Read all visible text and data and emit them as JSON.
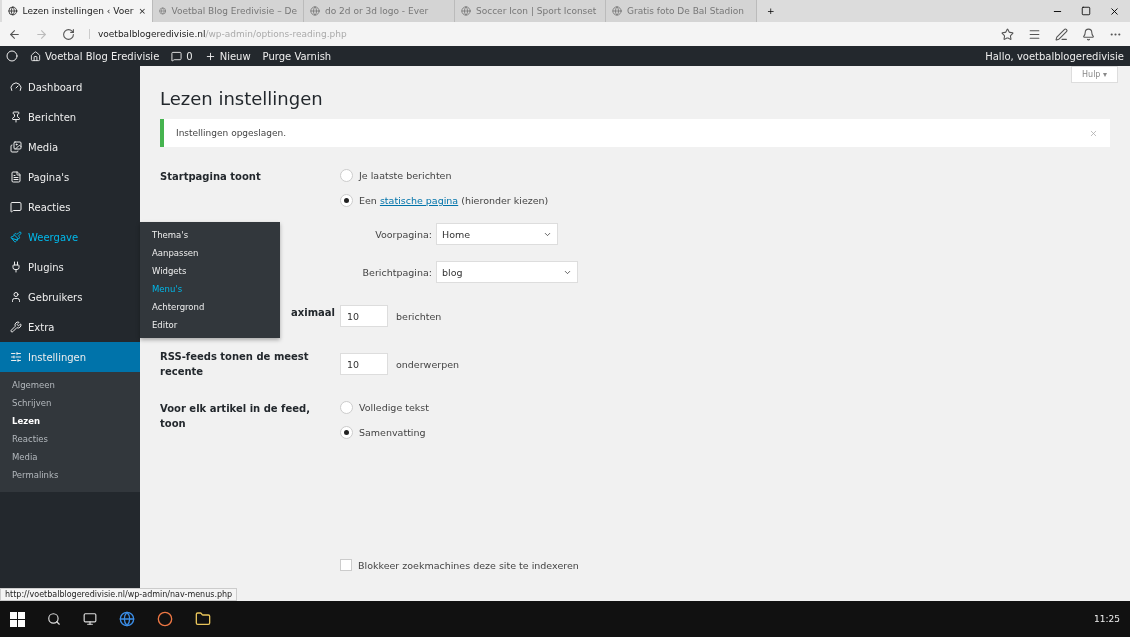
{
  "browser": {
    "tabs": [
      {
        "title": "Lezen instellingen ‹ Voer",
        "selected": true,
        "close": "×"
      },
      {
        "title": "Voetbal Blog Eredivisie – De",
        "selected": false
      },
      {
        "title": "do 2d or 3d logo - Ever",
        "selected": false
      },
      {
        "title": "Soccer Icon | Sport Iconset",
        "selected": false
      },
      {
        "title": "Gratis foto De Bal Stadion",
        "selected": false
      }
    ],
    "new_tab": "+",
    "url_host": "voetbalblogeredivisie.nl",
    "url_path": "/wp-admin/options-reading.php"
  },
  "admin_bar": {
    "site": "Voetbal Blog Eredivisie",
    "comments": "0",
    "new": "Nieuw",
    "purge": "Purge Varnish",
    "greeting": "Hallo, voetbalblogeredivisie"
  },
  "sidebar": {
    "items": [
      {
        "label": "Dashboard",
        "selected": false,
        "hovered": false
      },
      {
        "label": "Berichten",
        "selected": false,
        "hovered": false
      },
      {
        "label": "Media",
        "selected": false,
        "hovered": false
      },
      {
        "label": "Pagina's",
        "selected": false,
        "hovered": false
      },
      {
        "label": "Reacties",
        "selected": false,
        "hovered": false
      },
      {
        "label": "Weergave",
        "selected": false,
        "hovered": true,
        "flyout": [
          {
            "label": "Thema's",
            "hovered": false
          },
          {
            "label": "Aanpassen",
            "hovered": false
          },
          {
            "label": "Widgets",
            "hovered": false
          },
          {
            "label": "Menu's",
            "hovered": true
          },
          {
            "label": "Achtergrond",
            "hovered": false
          },
          {
            "label": "Editor",
            "hovered": false
          }
        ]
      },
      {
        "label": "Plugins",
        "selected": false,
        "hovered": false
      },
      {
        "label": "Gebruikers",
        "selected": false,
        "hovered": false
      },
      {
        "label": "Extra",
        "selected": false,
        "hovered": false
      },
      {
        "label": "Instellingen",
        "selected": true,
        "hovered": false,
        "children": [
          {
            "label": "Algemeen",
            "selected": false
          },
          {
            "label": "Schrijven",
            "selected": false
          },
          {
            "label": "Lezen",
            "selected": true
          },
          {
            "label": "Reacties",
            "selected": false
          },
          {
            "label": "Media",
            "selected": false
          },
          {
            "label": "Permalinks",
            "selected": false
          }
        ]
      }
    ]
  },
  "page": {
    "title": "Lezen instellingen",
    "help": "Hulp ▾",
    "notice": "Instellingen opgeslagen.",
    "rows": [
      {
        "kind": "radio",
        "label": "Startpagina toont",
        "options": [
          {
            "text": "Je laatste berichten",
            "checked": false
          },
          {
            "text": "Een",
            "link": "statische pagina",
            "text_after": "(hieronder kiezen)",
            "checked": true
          }
        ],
        "selects": [
          {
            "label": "Voorpagina:",
            "value": "Home"
          },
          {
            "label": "Berichtpagina:",
            "value": "blog"
          }
        ]
      },
      {
        "kind": "number",
        "label": "aximaal",
        "value": "10",
        "unit": "berichten"
      },
      {
        "kind": "number",
        "label": "RSS-feeds tonen de meest recente",
        "value": "10",
        "unit": "onderwerpen"
      },
      {
        "kind": "radio",
        "label": "Voor elk artikel in de feed, toon",
        "options": [
          {
            "text": "Volledige tekst",
            "checked": false
          },
          {
            "text": "Samenvatting",
            "checked": true
          }
        ]
      },
      {
        "kind": "checkbox",
        "text": "Blokkeer zoekmachines deze site te indexeren",
        "checked": false
      }
    ]
  },
  "status_url": "http://voetbalblogeredivisie.nl/wp-admin/nav-menus.php",
  "taskbar": {
    "time": "11:25"
  }
}
